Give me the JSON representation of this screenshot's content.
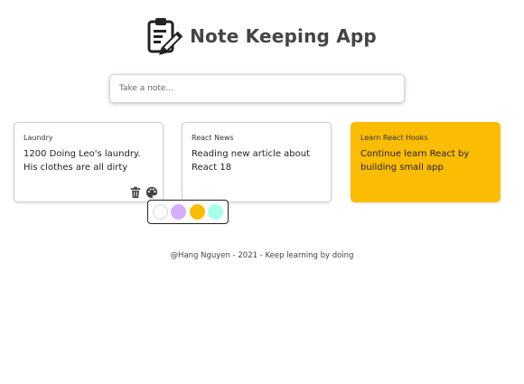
{
  "header": {
    "title": "Note Keeping App",
    "logo_icon": "clipboard-pencil-icon"
  },
  "composer": {
    "placeholder": "Take a note..."
  },
  "notes": [
    {
      "title": "Laundry",
      "body": "1200 Doing Leo's laundry. His clothes are all dirty",
      "background": "#ffffff",
      "actions": [
        "trash-icon",
        "palette-icon"
      ]
    },
    {
      "title": "React News",
      "body": "Reading new article about React 18",
      "background": "#ffffff"
    },
    {
      "title": "Learn React Hooks",
      "body": "Continue learn React by building small app",
      "background": "#fbbc04"
    }
  ],
  "color_palette": [
    "#ffffff",
    "#d7aefb",
    "#fbbc04",
    "#a7ffeb"
  ],
  "footer": {
    "text": "@Hang Nguyen - 2021 - Keep learning by doing"
  }
}
